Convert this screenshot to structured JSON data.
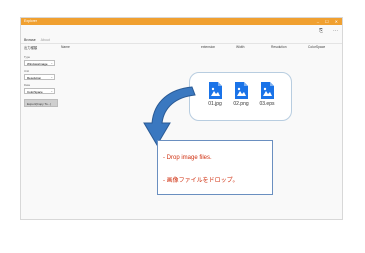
{
  "window": {
    "title": "Explorer",
    "controls": [
      "–",
      "☐",
      "✕"
    ],
    "toolbar": [
      "⎘",
      "···"
    ]
  },
  "tabs": [
    {
      "label": "Browse",
      "active": true
    },
    {
      "label": "About",
      "active": false
    }
  ],
  "columns": {
    "output": "出力種類",
    "name": "Name",
    "extension": "extension",
    "width": "Width",
    "resolution": "Resolution",
    "colorspace": "ColorSpace"
  },
  "left_panel": {
    "type_label": "Type",
    "type_value": "WindowsImage",
    "unit_label": "Unit",
    "unit_value": "Resolution",
    "data_label": "Data",
    "data_value": "ColorSpace",
    "export_button": "Export(Copy To...)"
  },
  "files": [
    {
      "name": "01.jpg"
    },
    {
      "name": "02.png"
    },
    {
      "name": "03.eps"
    }
  ],
  "callout": {
    "line1": "- Drop image files.",
    "line2": "- 画像ファイルをドロップ。"
  },
  "colors": {
    "titlebar": "#f0a030",
    "file_icon": "#1a73e8",
    "message": "#d03010",
    "arrow": "#3a78c0"
  }
}
